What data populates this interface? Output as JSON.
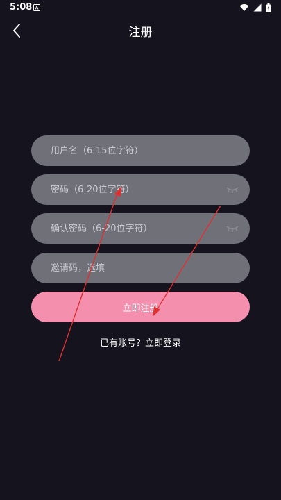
{
  "status_bar": {
    "time": "5:08",
    "icons": [
      "notification-a-icon",
      "wifi-icon",
      "signal-icon",
      "battery-charging-icon"
    ]
  },
  "header": {
    "title": "注册",
    "back_icon": "chevron-left-icon"
  },
  "form": {
    "username_placeholder": "用户名（6-15位字符）",
    "password_placeholder": "密码（6-20位字符）",
    "confirm_placeholder": "确认密码（6-20位字符）",
    "invite_placeholder": "邀请码，选填",
    "submit_label": "立即注册",
    "login_prompt": "已有账号？立即登录"
  },
  "colors": {
    "background": "#14131e",
    "input_fill": "#707078",
    "submit_fill": "#f48fad",
    "annotation_red": "#e03030"
  }
}
